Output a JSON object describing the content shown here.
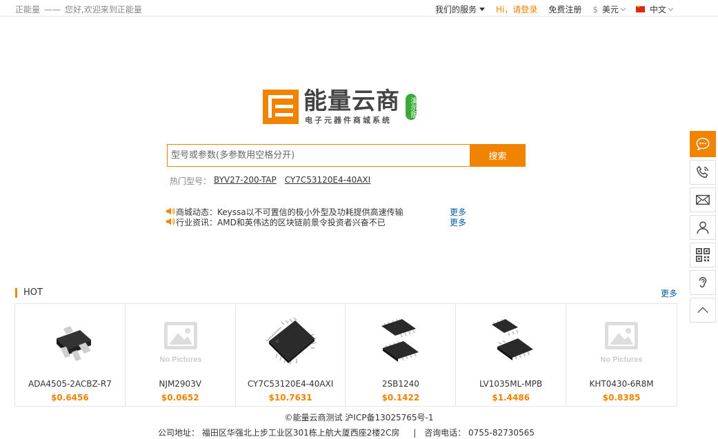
{
  "topbar": {
    "brand": "正能量",
    "dash": "——",
    "welcome": "您好,欢迎来到正能量",
    "services": "我们的服务",
    "login": "Hi，请登录",
    "register": "免费注册",
    "currency_symbol": "$",
    "currency": "美元",
    "language": "中文"
  },
  "logo": {
    "name": "能量云商",
    "subtitle": "电子元器件商城系统",
    "badge": "演示版"
  },
  "search": {
    "placeholder": "型号或参数(多参数用空格分开)",
    "button": "搜索"
  },
  "hot_tags": {
    "label": "热门型号：",
    "items": [
      "BYV27-200-TAP",
      "CY7C53120E4-40AXI"
    ]
  },
  "news": [
    {
      "text": "商城动态：Keyssa以不可置信的极小外型及功耗提供高速传输",
      "more": "更多"
    },
    {
      "text": "行业资讯：AMD和英伟达的区块链前景令投资者兴奋不已",
      "more": "更多"
    }
  ],
  "hot": {
    "title": "HOT",
    "more": "更多",
    "no_pictures": "No Pictures",
    "products": [
      {
        "name": "ADA4505-2ACBZ-R7",
        "price": "$0.6456",
        "image": "sot-chip"
      },
      {
        "name": "NJM2903V",
        "price": "$0.0652",
        "image": "no-pictures"
      },
      {
        "name": "CY7C53120E4-40AXI",
        "price": "$10.7631",
        "image": "qfp-chip"
      },
      {
        "name": "2SB1240",
        "price": "$0.1422",
        "image": "soic-chips"
      },
      {
        "name": "LV1035ML-MPB",
        "price": "$1.4486",
        "image": "msop-chips"
      },
      {
        "name": "KHT0430-6R8M",
        "price": "$0.8385",
        "image": "no-pictures"
      }
    ]
  },
  "footer": {
    "copyright": "©能量云商测试 沪ICP备13025765号-1",
    "address_label": "公司地址：",
    "address": "福田区华强北上步工业区301栋上航大厦西座2楼2C房",
    "separator": "|",
    "phone_label": "咨询电话：",
    "phone": "0755-82730565"
  },
  "colors": {
    "accent": "#f08300",
    "link": "#0b5ca8",
    "badge": "#3aa935"
  },
  "sidebar": [
    "chat-icon",
    "phone-icon",
    "mail-icon",
    "user-icon",
    "qrcode-icon",
    "ear-icon",
    "back-to-top-icon"
  ]
}
